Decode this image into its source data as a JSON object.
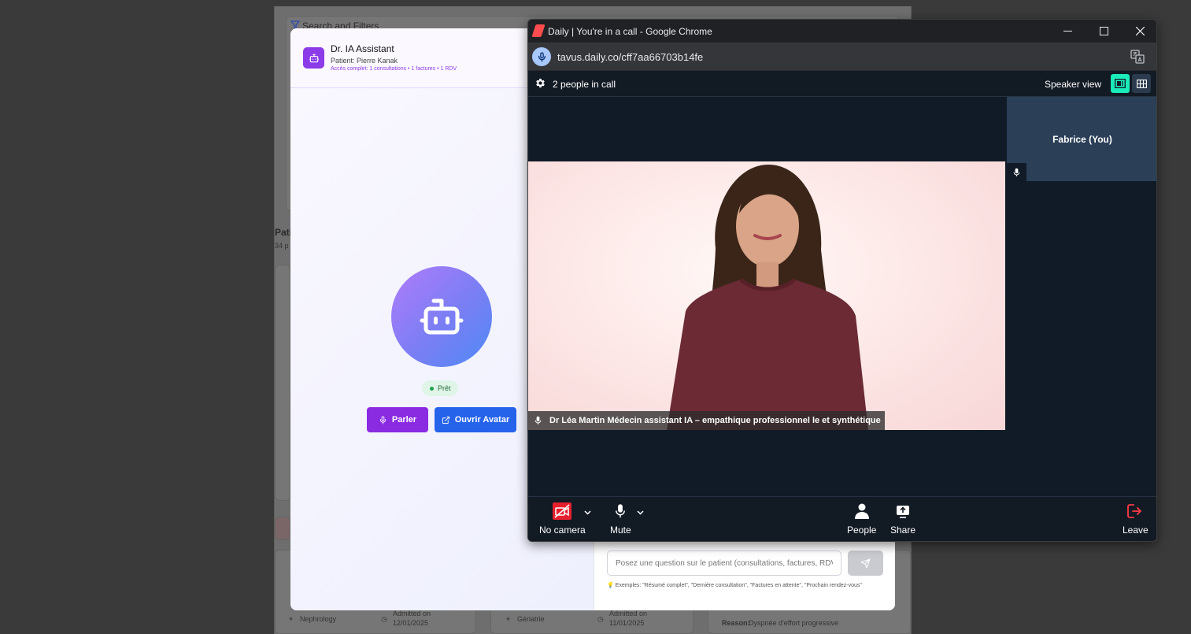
{
  "background": {
    "filters_title": "Search and Filters",
    "section_title": "Pati",
    "section_count": "34 p",
    "cards": [
      {
        "dept": "Nephrology",
        "admitted_label": "Admitted on",
        "admitted_date": "12/01/2025"
      },
      {
        "dept": "Gériatrie",
        "admitted_label": "Admitted on",
        "admitted_date": "11/01/2025"
      },
      {
        "reason_label": "Reason:",
        "reason": "Dyspnée d'effort progressive"
      }
    ]
  },
  "assistant": {
    "title": "Dr. IA Assistant",
    "patient": "Patient: Pierre Kanak",
    "access": "Accès complet: 1 consultations • 1 factures • 1 RDV",
    "status": "Prêt",
    "speak_label": "Parler",
    "open_avatar_label": "Ouvrir Avatar",
    "question_placeholder": "Posez une question sur le patient (consultations, factures, RDV...)",
    "examples": "💡 Exemples: \"Résumé complet\", \"Dernière consultation\", \"Factures en attente\", \"Prochain rendez-vous\""
  },
  "chrome": {
    "window_title": "Daily | You're in a call - Google Chrome",
    "url": "tavus.daily.co/cff7aa66703b14fe"
  },
  "call": {
    "people_count": "2 people in call",
    "view_mode": "Speaker view",
    "speaker_label": "Dr Léa Martin Médecin assistant IA – empathique professionnel le et synthétique",
    "self_label": "Fabrice (You)",
    "tray": {
      "camera": "No camera",
      "mute": "Mute",
      "people": "People",
      "share": "Share",
      "leave": "Leave"
    }
  },
  "colors": {
    "accent_purple": "#8a2be2",
    "accent_blue": "#2563eb",
    "daily_teal": "#1bebb9",
    "camera_off_red": "#e5202e",
    "leave_red": "#ff3b46"
  }
}
